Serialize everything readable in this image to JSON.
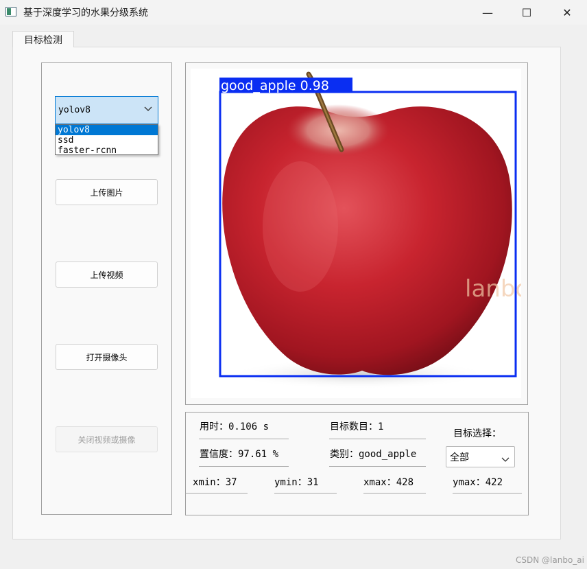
{
  "window": {
    "title": "基于深度学习的水果分级系统",
    "minimize_icon": "—",
    "maximize_icon": "☐",
    "close_icon": "✕"
  },
  "tabs": [
    {
      "label": "目标检测"
    }
  ],
  "left_panel": {
    "model_combo": {
      "selected": "yolov8",
      "options": [
        "yolov8",
        "ssd",
        "faster-rcnn"
      ]
    },
    "buttons": {
      "upload_image": "上传图片",
      "upload_video": "上传视频",
      "open_camera": "打开摄像头",
      "close_video_camera": "关闭视频或摄像"
    }
  },
  "detection": {
    "label_text": "good_apple 0.98",
    "box_color": "#0a2ef2",
    "overlay_watermark": "lanbo_ai"
  },
  "results": {
    "time_label": "用时：",
    "time_value": "0.106 s",
    "count_label": "目标数目：",
    "count_value": "1",
    "target_select_label": "目标选择：",
    "confidence_label": "置信度：",
    "confidence_value": "97.61 %",
    "class_label": "类别：",
    "class_value": "good_apple",
    "target_select_value": "全部",
    "xmin_label": "xmin：",
    "xmin_value": "37",
    "ymin_label": "ymin：",
    "ymin_value": "31",
    "xmax_label": "xmax：",
    "xmax_value": "428",
    "ymax_label": "ymax：",
    "ymax_value": "422"
  },
  "footer": {
    "watermark": "CSDN @lanbo_ai"
  }
}
